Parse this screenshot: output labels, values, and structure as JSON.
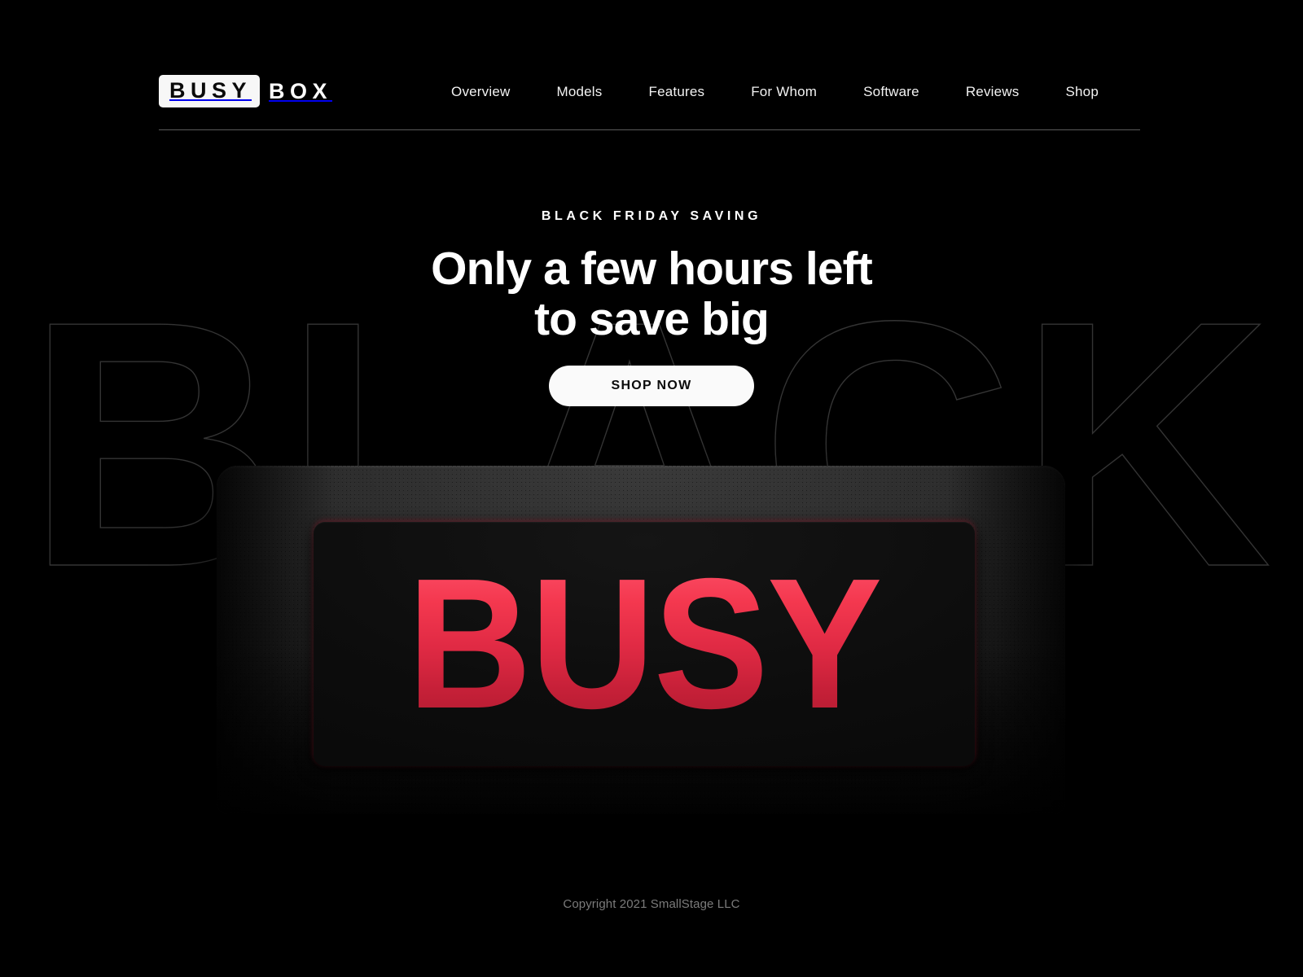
{
  "brand": {
    "mark_text": "BUSY",
    "word_text": "BOX"
  },
  "nav": {
    "items": [
      {
        "label": "Overview"
      },
      {
        "label": "Models"
      },
      {
        "label": "Features"
      },
      {
        "label": "For Whom"
      },
      {
        "label": "Software"
      },
      {
        "label": "Reviews"
      },
      {
        "label": "Shop"
      }
    ]
  },
  "hero": {
    "eyebrow": "BLACK FRIDAY SAVING",
    "headline": "Only a few hours left\nto save big",
    "cta_label": "SHOP NOW",
    "background_word": "BLACK"
  },
  "device": {
    "screen_text": "BUSY"
  },
  "footer": {
    "copyright": "Copyright 2021 SmallStage LLC"
  },
  "colors": {
    "page_background": "#000000",
    "text_primary": "#ffffff",
    "accent_red_light": "#fa4a62",
    "accent_red_dark": "#b51c32",
    "rule": "#5b5b5b",
    "outline_word": "#343434",
    "footer_text": "#7b7b7b",
    "cta_background": "#fafafa",
    "cta_text": "#0b0b0b"
  }
}
